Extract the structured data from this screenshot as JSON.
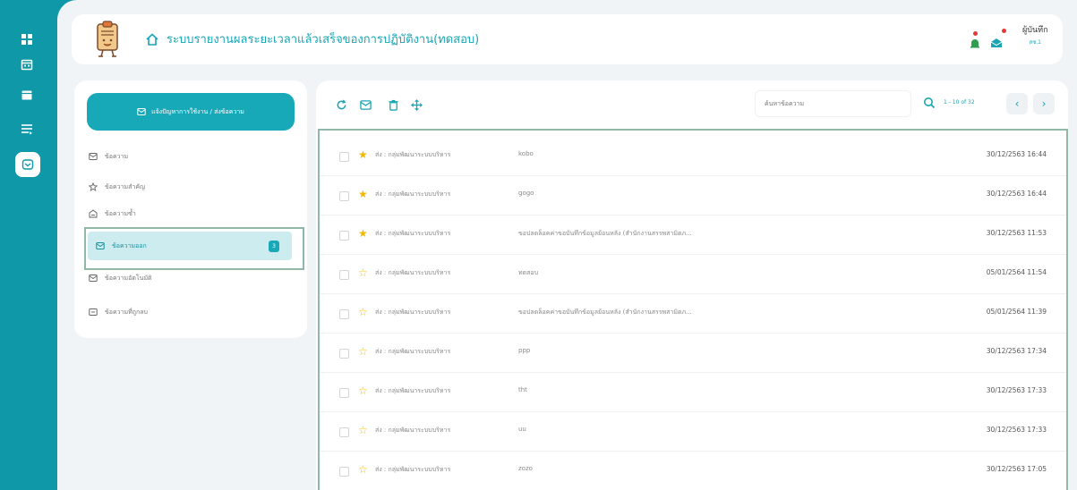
{
  "header": {
    "title": "ระบบรายงานผลระยะเวลาแล้วเสร็จของการปฏิบัติงาน(ทดสอบ)",
    "user_name": "ผู้บันทึก",
    "user_sub": "สช.1"
  },
  "sidebar": {
    "compose_label": "แจ้งปัญหาการใช้งาน / ส่งข้อความ",
    "items": [
      {
        "label": "ข้อความ",
        "icon": "inbox-icon"
      },
      {
        "label": "ข้อความสำคัญ",
        "icon": "star-icon"
      },
      {
        "label": "ข้อความซ้ำ",
        "icon": "archive-icon"
      },
      {
        "label": "ข้อความออก",
        "icon": "outbox-icon",
        "badge": "3"
      },
      {
        "label": "ข้อความอัตโนมัติ",
        "icon": "auto-mail-icon"
      },
      {
        "label": "ข้อความที่ถูกลบ",
        "icon": "trash-mail-icon"
      }
    ]
  },
  "toolbar": {
    "search_placeholder": "ค้นหาข้อความ",
    "pager_info": "1 - 10 of 32",
    "prev": "‹",
    "next": "›"
  },
  "messages": [
    {
      "star": true,
      "sender": "ส่ง : กลุ่มพัฒนาระบบบริหาร",
      "subject": "kobo",
      "date": "30/12/2563 16:44"
    },
    {
      "star": true,
      "sender": "ส่ง : กลุ่มพัฒนาระบบบริหาร",
      "subject": "gogo",
      "date": "30/12/2563 16:44"
    },
    {
      "star": true,
      "sender": "ส่ง : กลุ่มพัฒนาระบบบริหาร",
      "subject": "ขอปลดล็อคค่าขอบันทึกข้อมูลย้อนหลัง (สำนักงานสรรพสามิตภ...",
      "date": "30/12/2563 11:53"
    },
    {
      "star": false,
      "sender": "ส่ง : กลุ่มพัฒนาระบบบริหาร",
      "subject": "ทดสอบ",
      "date": "05/01/2564 11:54"
    },
    {
      "star": false,
      "sender": "ส่ง : กลุ่มพัฒนาระบบบริหาร",
      "subject": "ขอปลดล็อคค่าขอบันทึกข้อมูลย้อนหลัง (สำนักงานสรรพสามิตภ...",
      "date": "05/01/2564 11:39"
    },
    {
      "star": false,
      "sender": "ส่ง : กลุ่มพัฒนาระบบบริหาร",
      "subject": "ppp",
      "date": "30/12/2563 17:34"
    },
    {
      "star": false,
      "sender": "ส่ง : กลุ่มพัฒนาระบบบริหาร",
      "subject": "tht",
      "date": "30/12/2563 17:33"
    },
    {
      "star": false,
      "sender": "ส่ง : กลุ่มพัฒนาระบบบริหาร",
      "subject": "uu",
      "date": "30/12/2563 17:33"
    },
    {
      "star": false,
      "sender": "ส่ง : กลุ่มพัฒนาระบบบริหาร",
      "subject": "zozo",
      "date": "30/12/2563 17:05"
    }
  ],
  "colors": {
    "accent": "#18a9b8",
    "rail": "#0f99a8",
    "star": "#f5b800",
    "highlight": "#8fb9a6"
  }
}
